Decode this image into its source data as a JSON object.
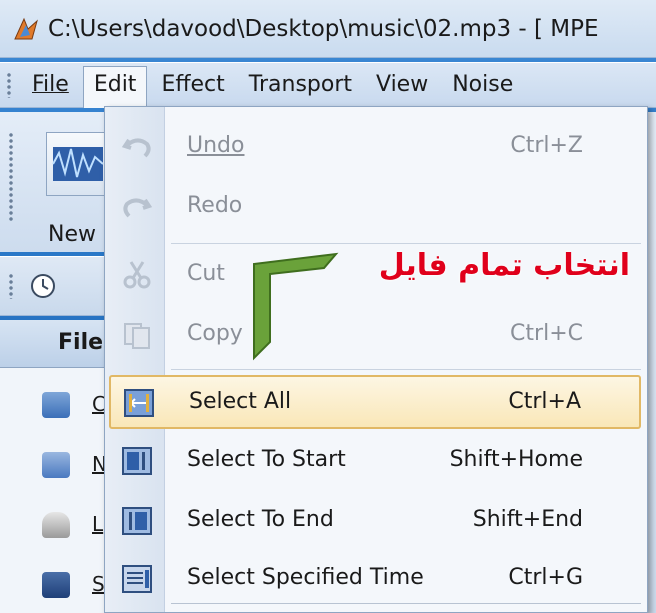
{
  "window": {
    "title": "C:\\Users\\davood\\Desktop\\music\\02.mp3 - [ MPE"
  },
  "menubar": {
    "items": [
      {
        "label": "File",
        "open": false
      },
      {
        "label": "Edit",
        "open": true
      },
      {
        "label": "Effect",
        "open": false
      },
      {
        "label": "Transport",
        "open": false
      },
      {
        "label": "View",
        "open": false
      },
      {
        "label": "Noise",
        "open": false
      }
    ]
  },
  "toolbar": {
    "new_label": "New"
  },
  "left_panel": {
    "header": "File",
    "rows": [
      "C",
      "N",
      "L",
      "S"
    ]
  },
  "edit_menu": {
    "items": [
      {
        "label": "Undo",
        "shortcut": "Ctrl+Z",
        "enabled": false,
        "icon": "undo-icon"
      },
      {
        "label": "Redo",
        "shortcut": "",
        "enabled": false,
        "icon": "redo-icon"
      },
      {
        "label": "Cut",
        "shortcut": "",
        "enabled": false,
        "icon": "cut-icon"
      },
      {
        "label": "Copy",
        "shortcut": "Ctrl+C",
        "enabled": false,
        "icon": "copy-icon"
      },
      {
        "label": "Select All",
        "shortcut": "Ctrl+A",
        "enabled": true,
        "highlighted": true,
        "icon": "select-all-icon"
      },
      {
        "label": "Select To Start",
        "shortcut": "Shift+Home",
        "enabled": true,
        "icon": "select-to-start-icon"
      },
      {
        "label": "Select To End",
        "shortcut": "Shift+End",
        "enabled": true,
        "icon": "select-to-end-icon"
      },
      {
        "label": "Select Specified Time",
        "shortcut": "Ctrl+G",
        "enabled": true,
        "icon": "select-time-icon"
      }
    ]
  },
  "annotation": {
    "text": "انتخاب تمام فایل",
    "color": "#e0001b",
    "arrow_color": "#6aa23a"
  }
}
